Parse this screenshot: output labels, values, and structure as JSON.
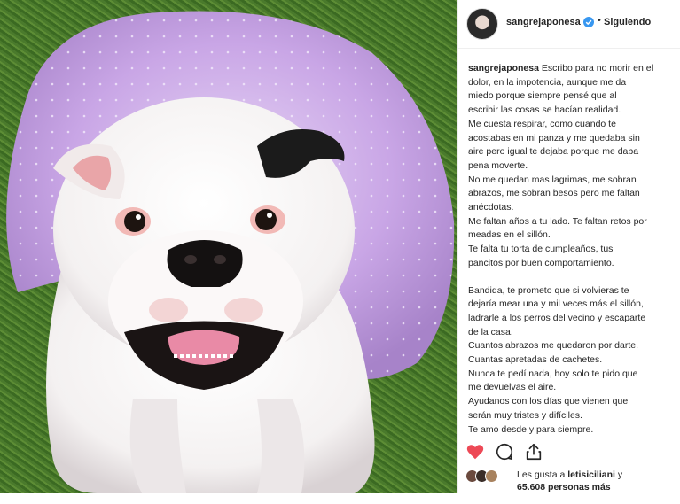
{
  "post": {
    "username": "sangrejaponesa",
    "follow_status": "Siguiendo",
    "dot": "•",
    "image_alt": "Bulldog blanco con tutú lila sobre el césped"
  },
  "caption": {
    "author": "sangrejaponesa",
    "lines": [
      "Escribo para no morir en el",
      "dolor, en la impotencia, aunque me da",
      "miedo porque siempre pensé que al",
      "escribir las cosas se hacían realidad.",
      "Me cuesta respirar, como cuando te",
      "acostabas en mi panza y me quedaba sin",
      "aire pero igual te dejaba porque me daba",
      "pena moverte.",
      "No me quedan mas lagrimas, me sobran",
      "abrazos, me sobran besos pero me faltan",
      "anécdotas.",
      "Me faltan años a tu lado. Te faltan retos por",
      "meadas en el sillón.",
      "Te falta tu torta de cumpleaños, tus",
      "pancitos por buen comportamiento.",
      "",
      "Bandida, te prometo que si volvieras te",
      "dejaría mear una y mil veces más el sillón,",
      "ladrarle a los perros del vecino y escaparte",
      " de la casa.",
      " Cuantos abrazos me quedaron por darte.",
      " Cuantas apretadas de cachetes.",
      " Nunca te pedí nada, hoy solo te pido que",
      " me devuelvas el aire.",
      " Ayudanos con los días que vienen que",
      " serán muy tristes y difíciles.",
      " Te amo desde y para siempre."
    ]
  },
  "actions": {
    "like_icon": "heart-icon",
    "comment_icon": "comment-icon",
    "share_icon": "share-icon",
    "like_color": "#ed4956"
  },
  "likes": {
    "prefix": "Les gusta a",
    "user": "letisiciliani",
    "middle": "y",
    "count": "65.608 personas más"
  },
  "colors": {
    "verified": "#3897f0",
    "tutu": "#c9a6e6"
  }
}
